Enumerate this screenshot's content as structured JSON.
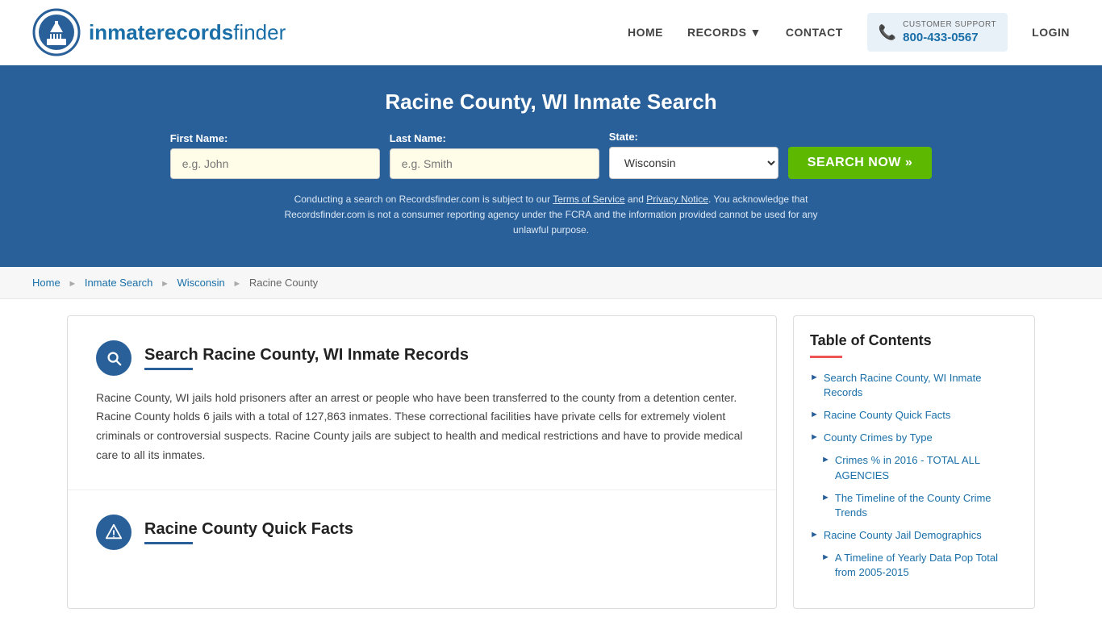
{
  "header": {
    "logo_text_regular": "inmaterecords",
    "logo_text_bold": "finder",
    "nav": {
      "home": "HOME",
      "records": "RECORDS",
      "contact": "CONTACT",
      "login": "LOGIN"
    },
    "support": {
      "label": "CUSTOMER SUPPORT",
      "number": "800-433-0567"
    }
  },
  "hero": {
    "title": "Racine County, WI Inmate Search",
    "form": {
      "first_name_label": "First Name:",
      "first_name_placeholder": "e.g. John",
      "last_name_label": "Last Name:",
      "last_name_placeholder": "e.g. Smith",
      "state_label": "State:",
      "state_value": "Wisconsin",
      "search_button": "SEARCH NOW »"
    },
    "disclaimer": "Conducting a search on Recordsfinder.com is subject to our Terms of Service and Privacy Notice. You acknowledge that Recordsfinder.com is not a consumer reporting agency under the FCRA and the information provided cannot be used for any unlawful purpose."
  },
  "breadcrumb": {
    "items": [
      "Home",
      "Inmate Search",
      "Wisconsin",
      "Racine County"
    ]
  },
  "content": {
    "section1": {
      "title": "Search Racine County, WI Inmate Records",
      "body": "Racine County, WI jails hold prisoners after an arrest or people who have been transferred to the county from a detention center. Racine County holds 6 jails with a total of 127,863 inmates. These correctional facilities have private cells for extremely violent criminals or controversial suspects. Racine County jails are subject to health and medical restrictions and have to provide medical care to all its inmates."
    },
    "section2": {
      "title": "Racine County Quick Facts"
    }
  },
  "sidebar": {
    "toc_title": "Table of Contents",
    "items": [
      {
        "label": "Search Racine County, WI Inmate Records",
        "indent": false
      },
      {
        "label": "Racine County Quick Facts",
        "indent": false
      },
      {
        "label": "County Crimes by Type",
        "indent": false
      },
      {
        "label": "Crimes % in 2016 - TOTAL ALL AGENCIES",
        "indent": true
      },
      {
        "label": "The Timeline of the County Crime Trends",
        "indent": true
      },
      {
        "label": "Racine County Jail Demographics",
        "indent": false
      },
      {
        "label": "A Timeline of Yearly Data Pop Total from 2005-2015",
        "indent": true
      }
    ]
  }
}
